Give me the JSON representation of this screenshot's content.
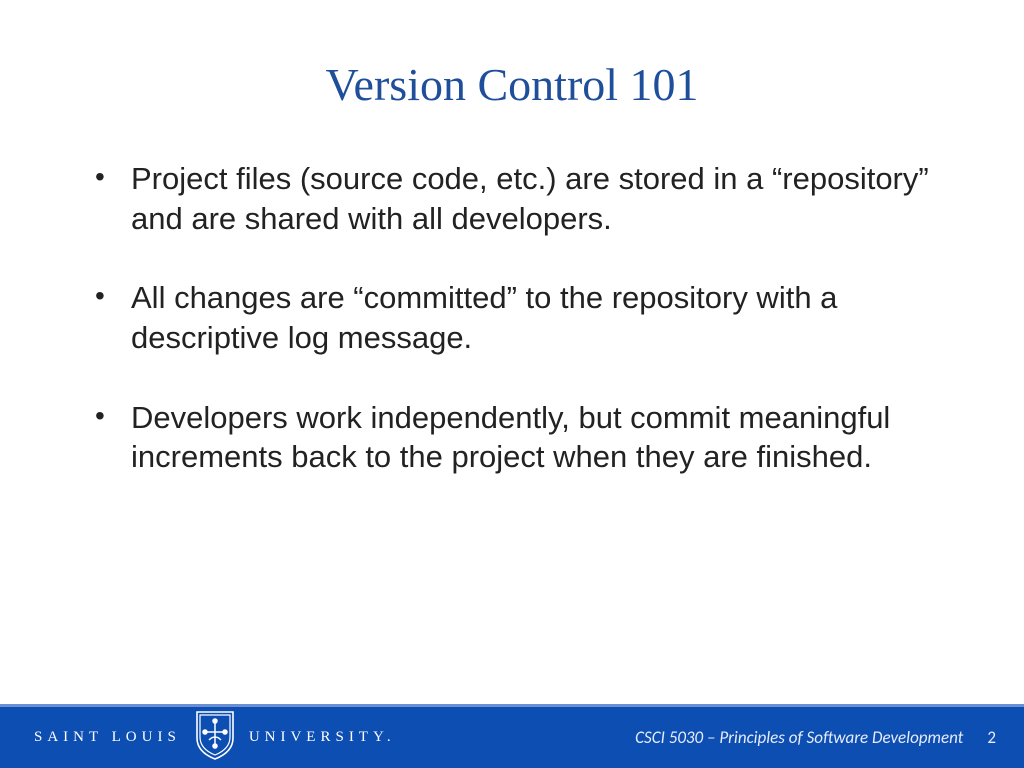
{
  "title": "Version Control 101",
  "bullets": [
    "Project files (source code, etc.) are stored in a “repository” and are shared with all developers.",
    "All changes are “committed” to the repository with a descriptive log message.",
    "Developers work independently, but commit meaningful increments back to the project when they are finished."
  ],
  "footer": {
    "org_left": "SAINT LOUIS",
    "org_right": "UNIVERSITY.",
    "course": "CSCI 5030 – Principles of Software Development",
    "page": "2"
  },
  "colors": {
    "title": "#1f4e9b",
    "footer_bg": "#0d4eb3",
    "footer_line": "#6a8fd4"
  }
}
